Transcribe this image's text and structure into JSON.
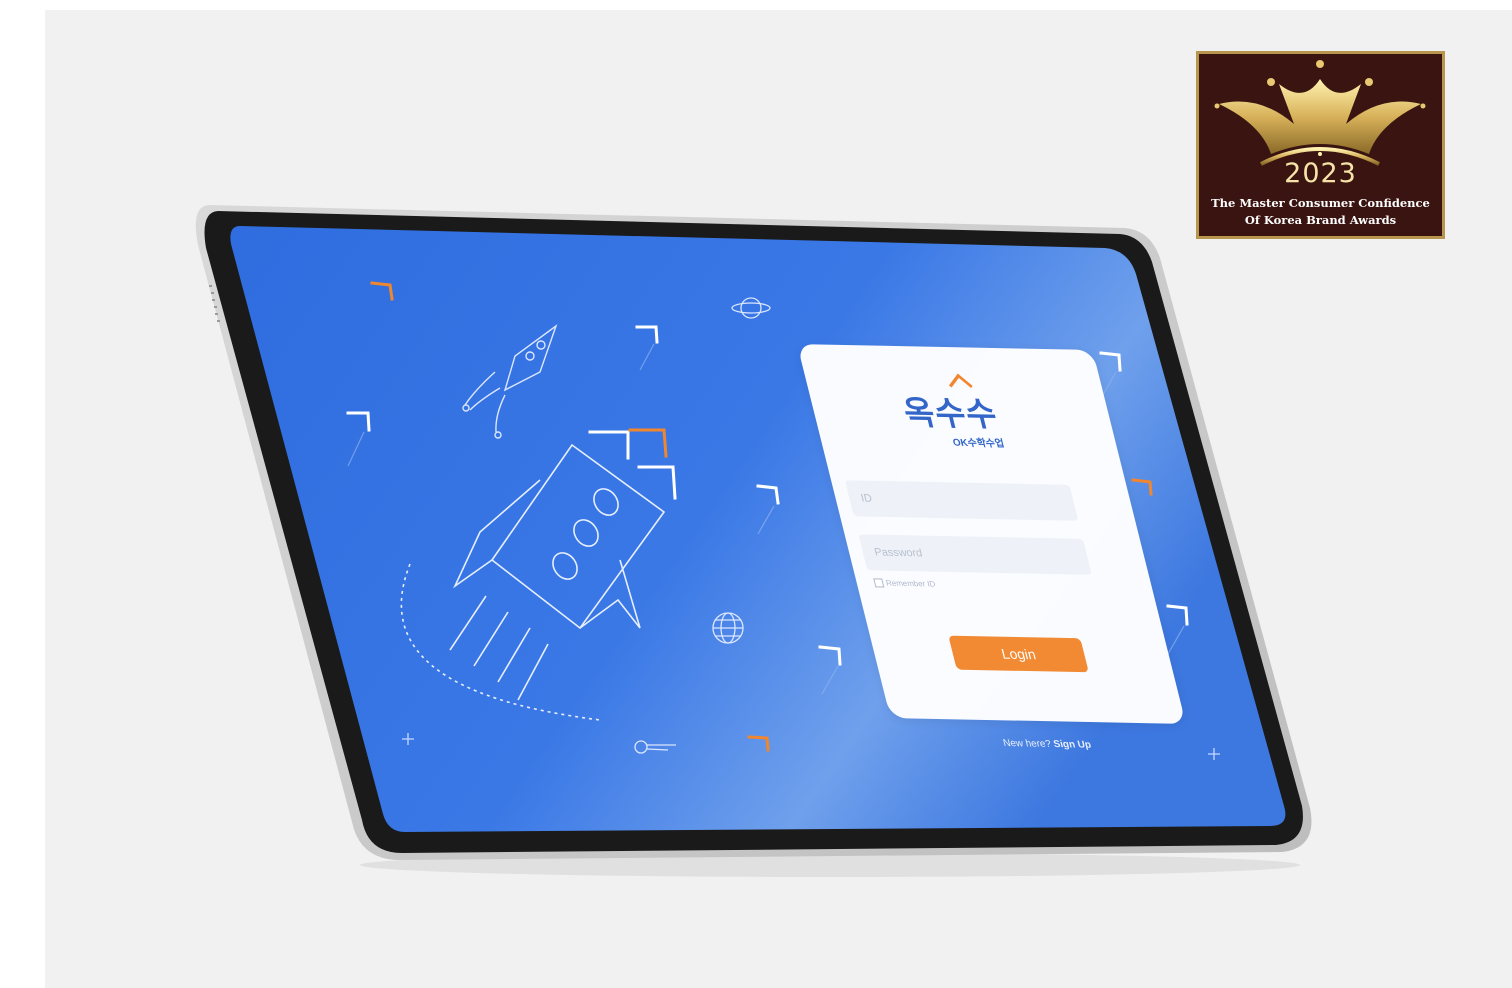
{
  "award": {
    "year": "2023",
    "line1": "The Master Consumer Confidence",
    "line2": "Of Korea Brand Awards",
    "background": "#3a1410",
    "gold": "#c9a24e"
  },
  "tablet": {
    "screen_color": "#3a74e0",
    "accent_orange": "#f0862e"
  },
  "login": {
    "logo_text": "옥수수",
    "logo_subtitle": "OK수학수업",
    "id_placeholder": "ID",
    "password_placeholder": "Password",
    "remember_label": "Remember ID",
    "login_label": "Login",
    "signup_prompt": "New here?",
    "signup_link": "Sign Up",
    "button_color": "#f18a33",
    "brand_color": "#3366c8"
  }
}
